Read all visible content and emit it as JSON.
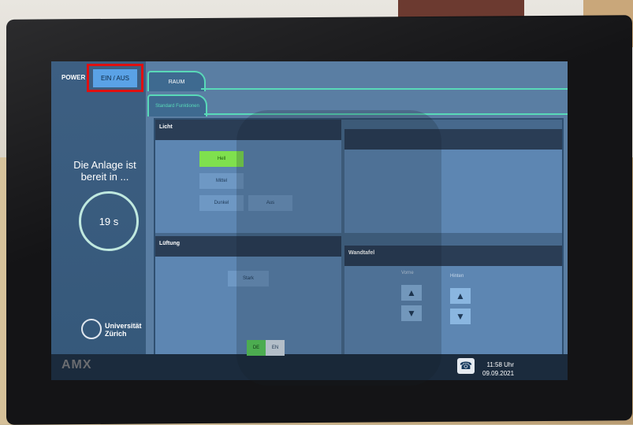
{
  "power": {
    "label": "POWER",
    "button": "EIN / AUS"
  },
  "status": {
    "ready_text": "Die Anlage ist bereit in ...",
    "countdown": "19 s"
  },
  "university": {
    "name": "Universität Zürich"
  },
  "tabs": {
    "raum": "RAUM",
    "standard": "Standard Funktionen"
  },
  "licht": {
    "title": "Licht",
    "buttons": [
      "Hell",
      "Mittel",
      "Dunkel",
      "Aus"
    ],
    "active": "Hell"
  },
  "lueftung": {
    "title": "Lüftung",
    "button": "Stark"
  },
  "wandtafel": {
    "title": "Wandtafel",
    "left": "Vorne",
    "right": "Hinten"
  },
  "lang": {
    "de": "DE",
    "en": "EN"
  },
  "footer": {
    "brand": "AMX",
    "time": "11:58 Uhr",
    "date": "09.09.2021"
  },
  "icons": [
    "arrow-up-icon",
    "arrow-down-icon",
    "phone-icon"
  ],
  "colors": {
    "highlight": "#e01010",
    "active": "#7fe04e",
    "tab_border": "#59d9b8"
  }
}
